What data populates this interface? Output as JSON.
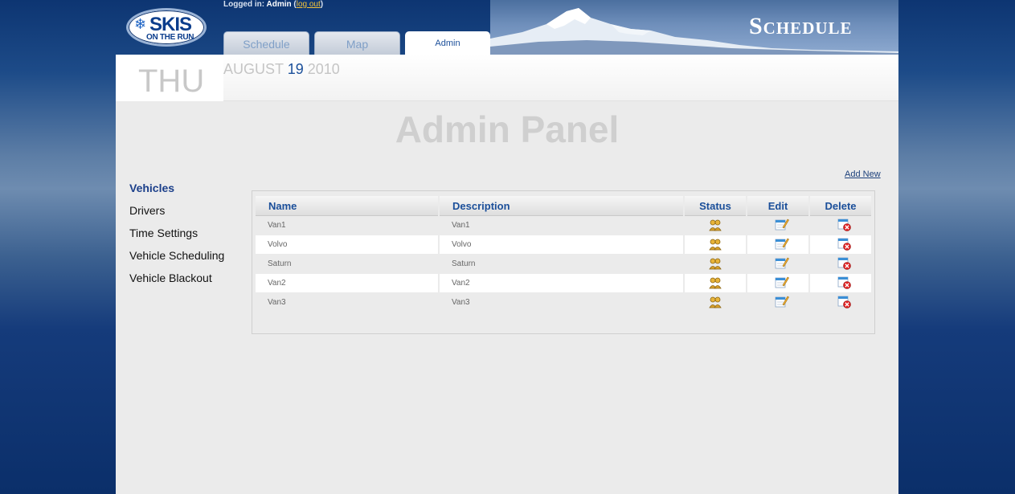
{
  "header": {
    "logo_main": "SKIS",
    "logo_sub": "ON THE RUN",
    "login_prefix": "Logged in:",
    "login_user": "Admin",
    "logout_label": "log out",
    "title": "Schedule"
  },
  "tabs": [
    {
      "label": "Schedule",
      "active": false
    },
    {
      "label": "Map",
      "active": false
    },
    {
      "label": "Admin",
      "active": true
    }
  ],
  "date": {
    "day": "THU",
    "month": "AUGUST",
    "num": "19",
    "year": "2010"
  },
  "panel": {
    "title": "Admin Panel",
    "add_new_label": "Add New"
  },
  "sidebar": {
    "items": [
      {
        "label": "Vehicles",
        "active": true
      },
      {
        "label": "Drivers",
        "active": false
      },
      {
        "label": "Time Settings",
        "active": false
      },
      {
        "label": "Vehicle Scheduling",
        "active": false
      },
      {
        "label": "Vehicle Blackout",
        "active": false
      }
    ]
  },
  "table": {
    "columns": [
      "Name",
      "Description",
      "Status",
      "Edit",
      "Delete"
    ],
    "rows": [
      {
        "name": "Van1",
        "description": "Van1",
        "status_icon": "users-icon",
        "edit_icon": "edit-icon",
        "delete_icon": "delete-icon"
      },
      {
        "name": "Volvo",
        "description": "Volvo",
        "status_icon": "users-icon",
        "edit_icon": "edit-icon",
        "delete_icon": "delete-icon"
      },
      {
        "name": "Saturn",
        "description": "Saturn",
        "status_icon": "users-icon",
        "edit_icon": "edit-icon",
        "delete_icon": "delete-icon"
      },
      {
        "name": "Van2",
        "description": "Van2",
        "status_icon": "users-icon",
        "edit_icon": "edit-icon",
        "delete_icon": "delete-icon"
      },
      {
        "name": "Van3",
        "description": "Van3",
        "status_icon": "users-icon",
        "edit_icon": "edit-icon",
        "delete_icon": "delete-icon"
      }
    ]
  },
  "colors": {
    "background": "#0b2f6a",
    "accent": "#1b4f9a",
    "panel": "#ebebeb",
    "logout_link": "#f3c33a"
  }
}
